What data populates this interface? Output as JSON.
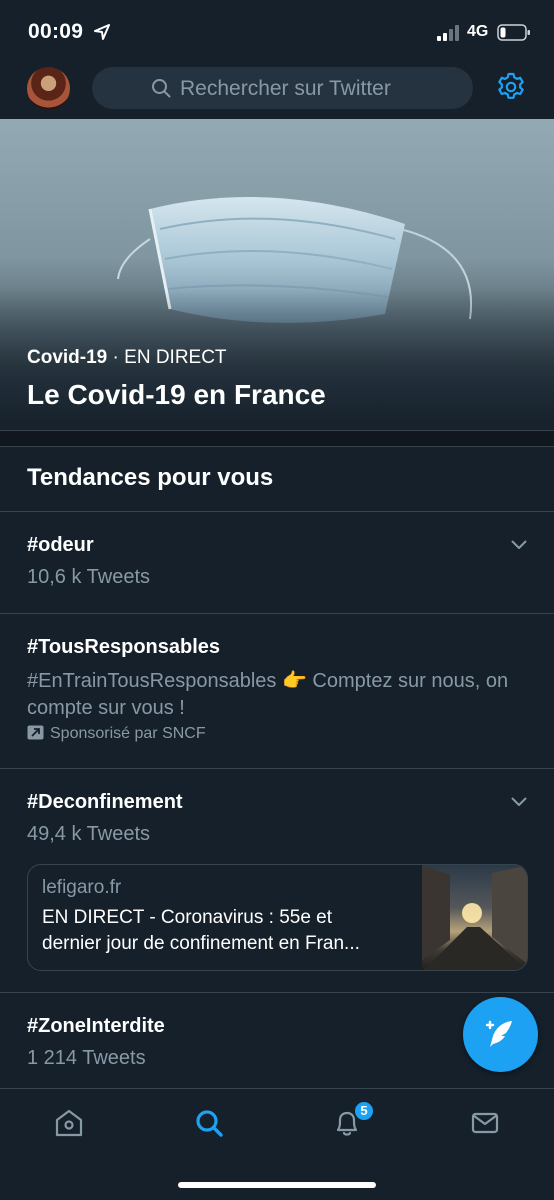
{
  "status_bar": {
    "time": "00:09",
    "network": "4G"
  },
  "header": {
    "search_placeholder": "Rechercher sur Twitter"
  },
  "hero": {
    "topic": "Covid-19",
    "separator": " · ",
    "status": "EN DIRECT",
    "title": "Le Covid-19 en France"
  },
  "section": {
    "title": "Tendances pour vous"
  },
  "trends": [
    {
      "tag": "#odeur",
      "count": "10,6 k Tweets"
    },
    {
      "tag": "#TousResponsables",
      "description": "#EnTrainTousResponsables 👉 Comptez sur nous, on compte sur vous !",
      "sponsor": "Sponsorisé par SNCF"
    },
    {
      "tag": "#Deconfinement",
      "count": "49,4 k Tweets",
      "card": {
        "source": "lefigaro.fr",
        "headline_line1": "EN DIRECT - Coronavirus : 55e et",
        "headline_line2": "dernier jour de confinement en Fran..."
      }
    },
    {
      "tag": "#ZoneInterdite",
      "count": "1 214 Tweets"
    }
  ],
  "tabbar": {
    "notifications_badge": "5"
  },
  "colors": {
    "background": "#15202b",
    "accent": "#1da1f2",
    "secondary_text": "#8899a6",
    "border": "#38444d"
  },
  "icons": [
    "location-arrow-icon",
    "signal-icon",
    "battery-icon",
    "search-icon",
    "gear-icon",
    "chevron-down-icon",
    "promoted-icon",
    "compose-tweet-icon",
    "home-icon",
    "explore-icon",
    "bell-icon",
    "mail-icon"
  ]
}
